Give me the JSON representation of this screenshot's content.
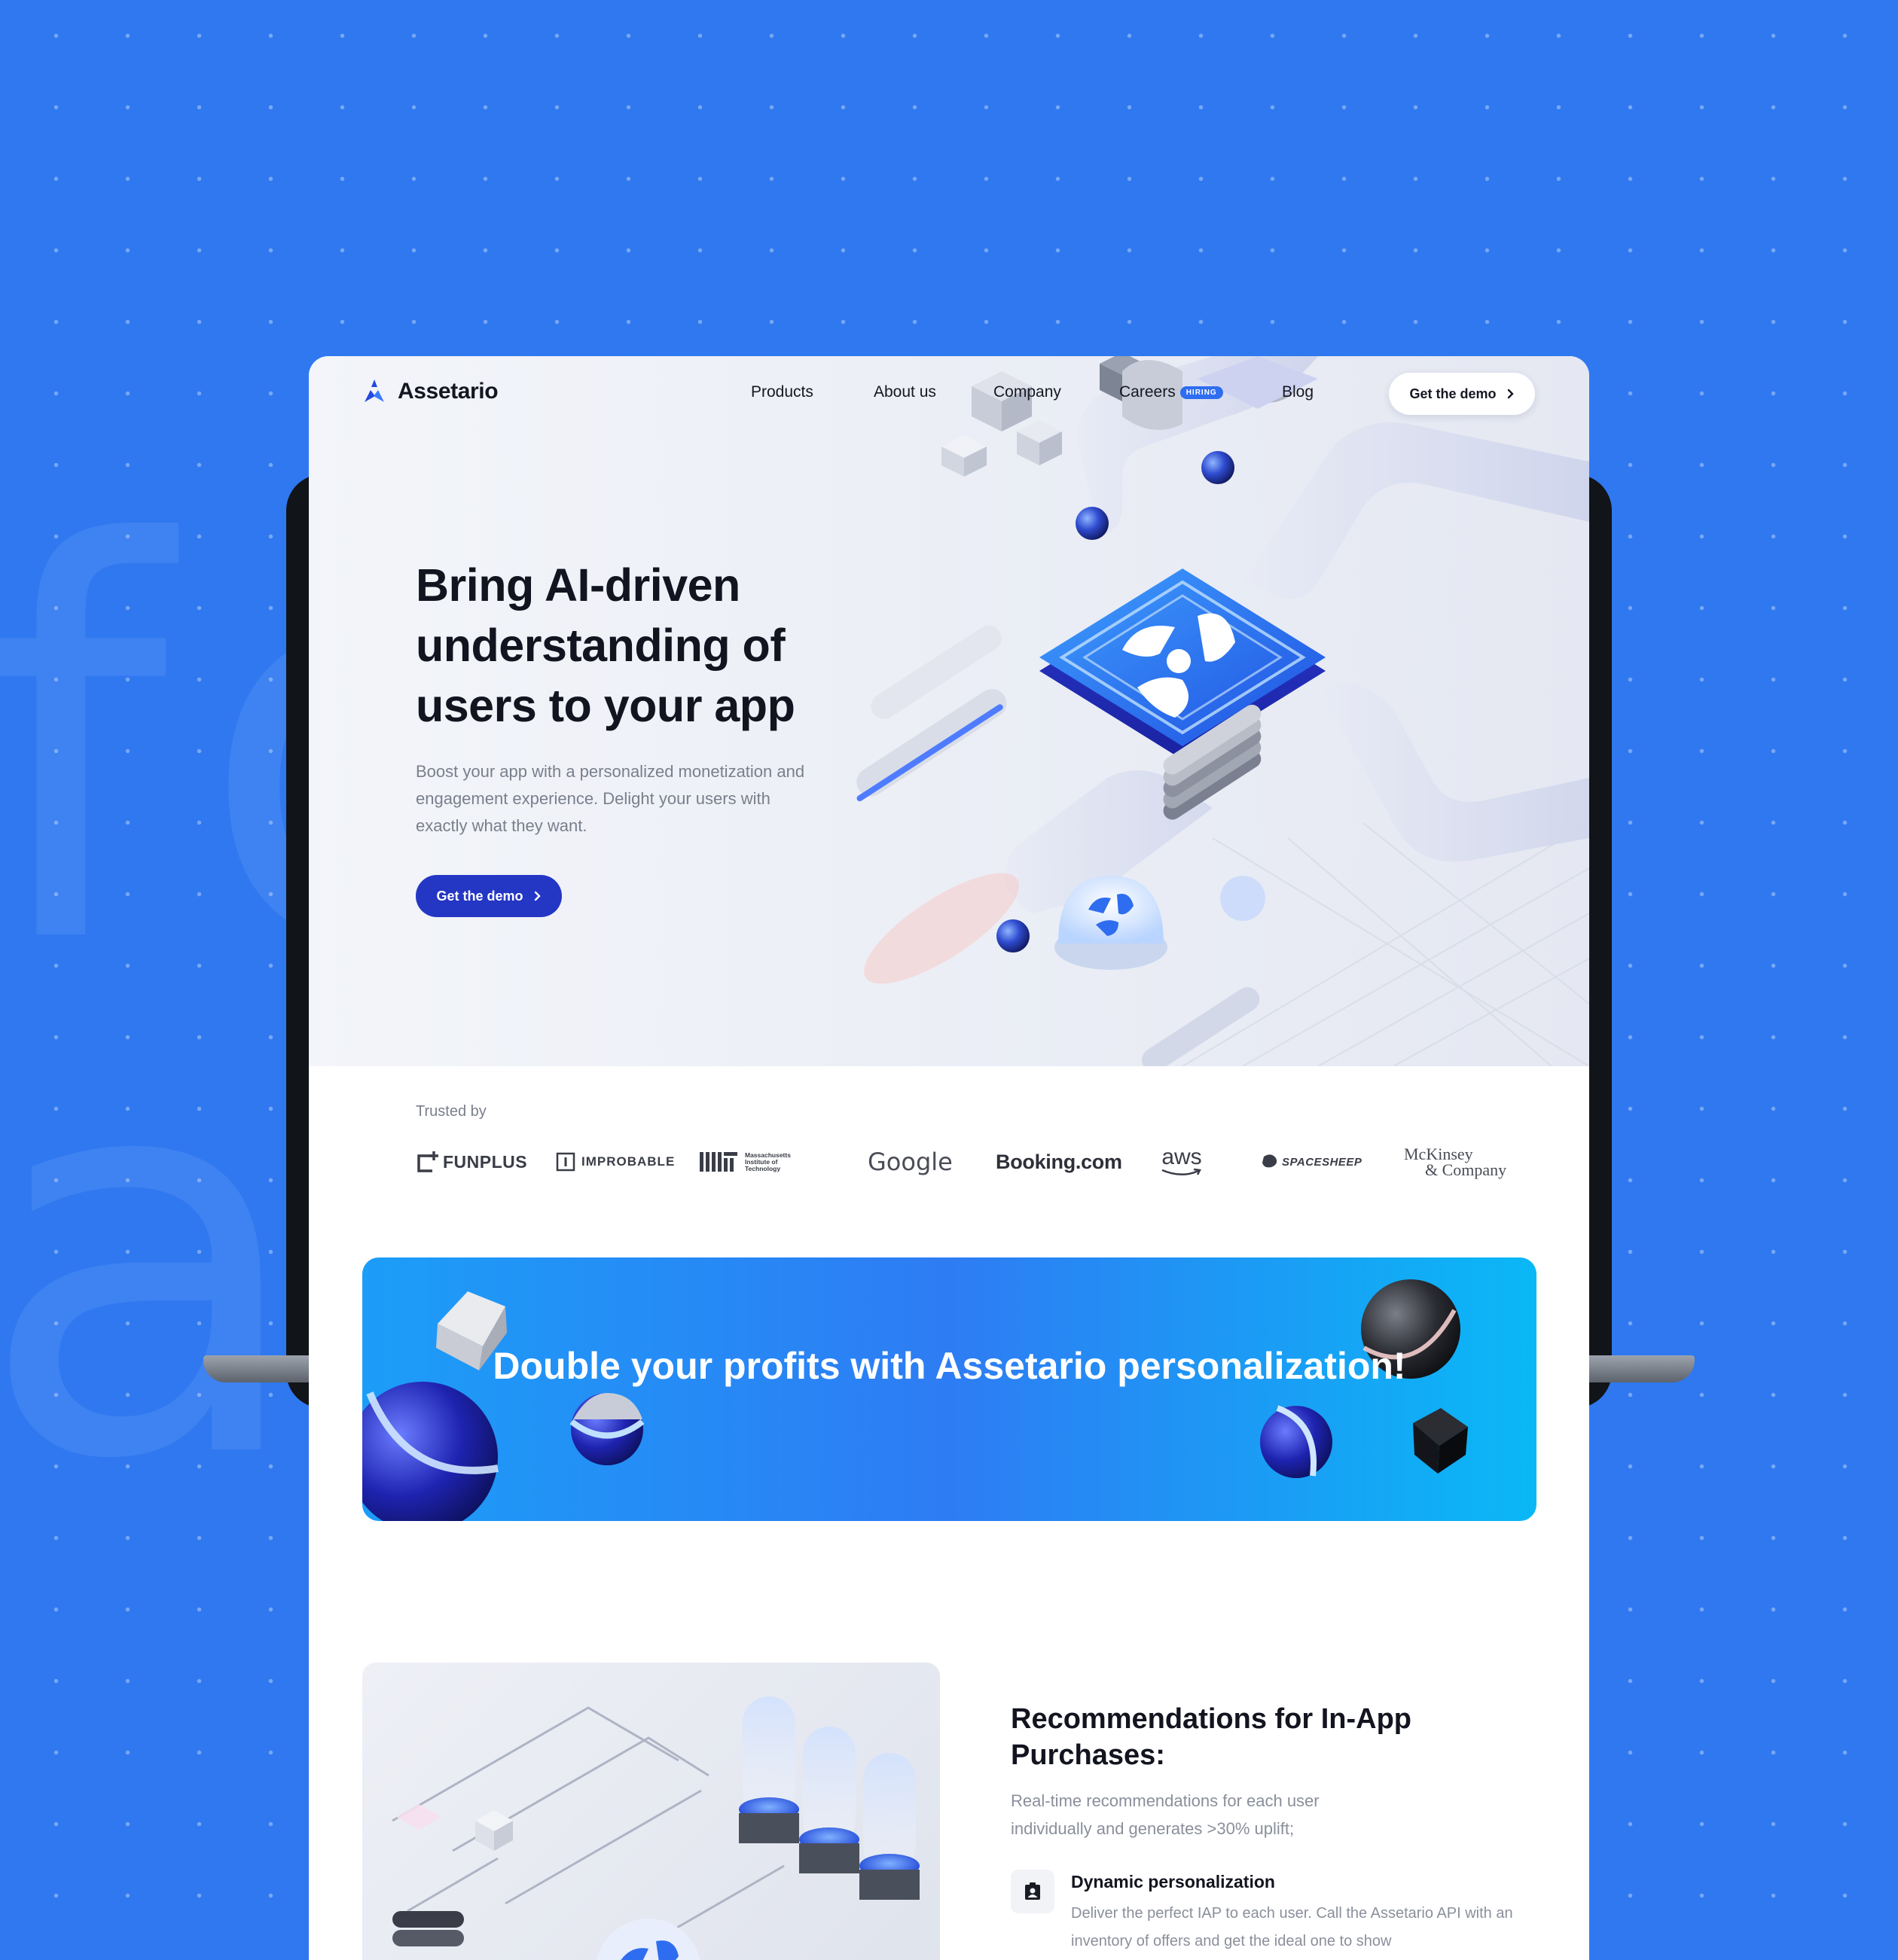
{
  "brand": {
    "name": "Assetario",
    "accent": "#2436c4",
    "badge_color": "#2f6df0",
    "background": "#2f78f0"
  },
  "nav": {
    "items": [
      "Products",
      "About us",
      "Company",
      "Careers",
      "Blog"
    ],
    "careers_badge": "HIRING",
    "cta": "Get the demo",
    "cta_icon": "chevron-right-icon"
  },
  "hero": {
    "title": "Bring AI-driven understanding of users to your app",
    "subtitle": "Boost your app with a personalized monetization and engagement experience. Delight your users with exactly what they want.",
    "cta": "Get the demo"
  },
  "trusted": {
    "label": "Trusted by",
    "logos": {
      "funplus": "FUNPLUS",
      "improbable": "IMPROBABLE",
      "mit": "Massachusetts Institute of Technology",
      "google": "Google",
      "booking": "Booking.com",
      "aws": "aws",
      "spacesheep": "SPACESHEEP",
      "mckinsey_line1": "McKinsey",
      "mckinsey_line2": "& Company"
    }
  },
  "banner": {
    "title": "Double your profits with Assetario personalization!"
  },
  "feature": {
    "title": "Recommendations for In-App Purchases:",
    "subtitle": "Real-time recommendations for each user individually and generates >30% uplift;",
    "item": {
      "icon": "user-badge-icon",
      "title": "Dynamic personalization",
      "description": "Deliver the perfect IAP to each user. Call the Assetario API with an inventory of offers and get the ideal one to show"
    }
  }
}
